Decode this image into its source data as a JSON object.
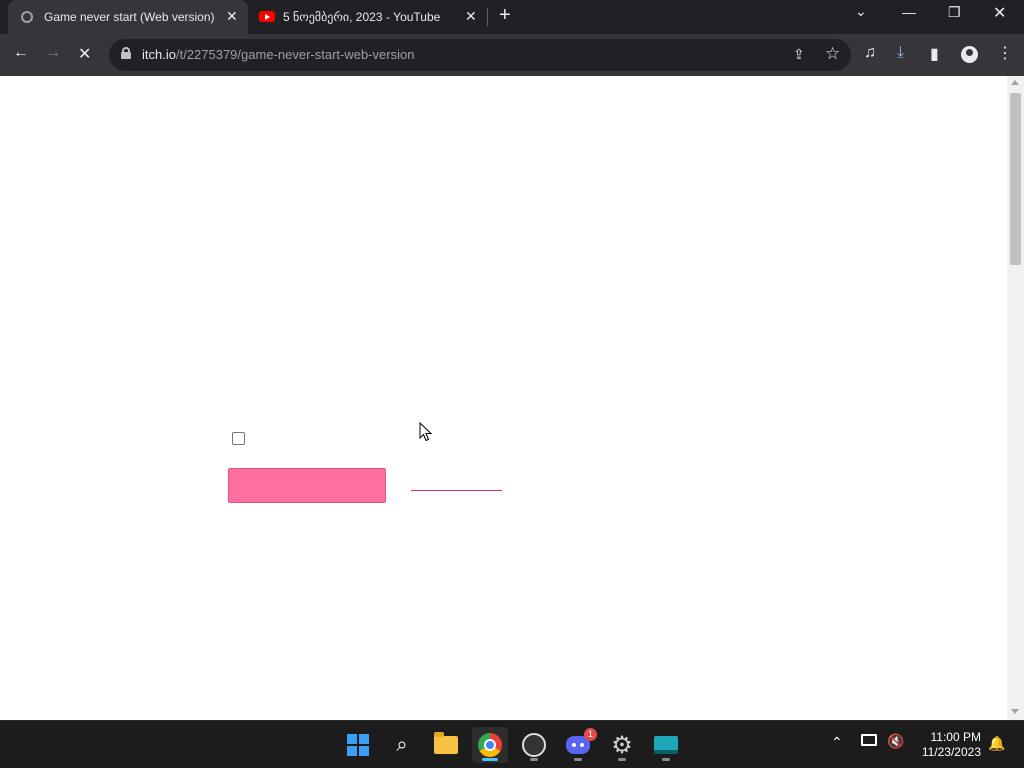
{
  "browser": {
    "tabs": [
      {
        "title": "Game never start (Web version)",
        "active": true,
        "favicon": "itch-loading-icon"
      },
      {
        "title": "5 ნოემბერი, 2023 - YouTube",
        "active": false,
        "favicon": "youtube-icon"
      }
    ],
    "new_tab_glyph": "+",
    "close_glyph": "✕",
    "window_controls": {
      "tab_search": "⌄",
      "minimize": "—",
      "restore": "❐",
      "close": "✕"
    },
    "toolbar": {
      "back": "←",
      "forward": "→",
      "stop": "✕",
      "share": "⇪",
      "bookmark": "☆",
      "media": "♫",
      "download": "⤓",
      "side_panel": "▮",
      "menu": "⋮"
    },
    "url": {
      "host": "itch.io",
      "path": "/t/2275379/game-never-start-web-version"
    }
  },
  "page": {
    "checkbox_checked": false,
    "colors": {
      "pink_bar": "#ff6f9f",
      "red_line": "#d4325f",
      "background": "#ffffff"
    }
  },
  "taskbar": {
    "apps": [
      "windows-start",
      "search",
      "file-explorer",
      "chrome",
      "obs-studio",
      "discord",
      "settings",
      "terminal"
    ],
    "active_app": "chrome",
    "discord_badge": "1",
    "settings_glyph": "⚙",
    "search_glyph": "⌕",
    "tray_chevron": "⌃",
    "volume_glyph": "🔇",
    "notification_glyph": "🔔",
    "clock": {
      "time": "11:00 PM",
      "date": "11/23/2023"
    }
  }
}
